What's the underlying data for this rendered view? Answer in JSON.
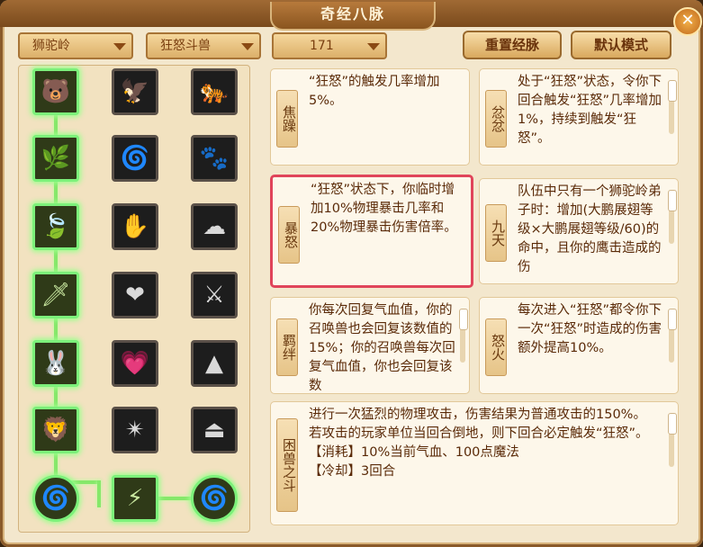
{
  "window": {
    "title": "奇经八脉",
    "close_symbol": "✕"
  },
  "dropdowns": {
    "school": "狮驼岭",
    "beast": "狂怒斗兽",
    "level": "171"
  },
  "buttons": {
    "reset": "重置经脉",
    "default": "默认模式"
  },
  "nodes": [
    {
      "icon": "🐻"
    },
    {
      "icon": "🦅"
    },
    {
      "icon": "🐅"
    },
    {
      "icon": "🌿"
    },
    {
      "icon": "🌀"
    },
    {
      "icon": "🐾"
    },
    {
      "icon": "🍃"
    },
    {
      "icon": "✋"
    },
    {
      "icon": "☁"
    },
    {
      "icon": "🗡"
    },
    {
      "icon": "❤"
    },
    {
      "icon": "⚔"
    },
    {
      "icon": "🐰"
    },
    {
      "icon": "💗"
    },
    {
      "icon": "▲"
    },
    {
      "icon": "🦁"
    },
    {
      "icon": "✴"
    },
    {
      "icon": "⏏"
    },
    {
      "icon": "🌀"
    },
    {
      "icon": "⚡"
    },
    {
      "icon": "🌀"
    }
  ],
  "cards": [
    {
      "name": "焦躁",
      "desc": "“狂怒”的触发几率增加5%。"
    },
    {
      "name": "忿忿",
      "desc": "处于“狂怒”状态，令你下回合触发“狂怒”几率增加1%，持续到触发“狂怒”。"
    },
    {
      "name": "暴怒",
      "desc": "“狂怒”状态下，你临时增加10%物理暴击几率和20%物理暴击伤害倍率。"
    },
    {
      "name": "九天",
      "desc": "队伍中只有一个狮驼岭弟子时：增加(大鹏展翅等级×大鹏展翅等级/60)的命中，且你的鹰击造成的伤"
    },
    {
      "name": "羁绊",
      "desc": "你每次回复气血值，你的召唤兽也会回复该数值的15%；你的召唤兽每次回复气血值，你也会回复该数"
    },
    {
      "name": "怒火",
      "desc": "每次进入“狂怒”都令你下一次“狂怒”时造成的伤害额外提高10%。"
    },
    {
      "name": "困兽之斗",
      "desc": "进行一次猛烈的物理攻击，伤害结果为普通攻击的150%。\n若攻击的玩家单位当回合倒地，则下回合必定触发“狂怒”。\n【消耗】10%当前气血、100点魔法\n【冷却】3回合"
    }
  ]
}
